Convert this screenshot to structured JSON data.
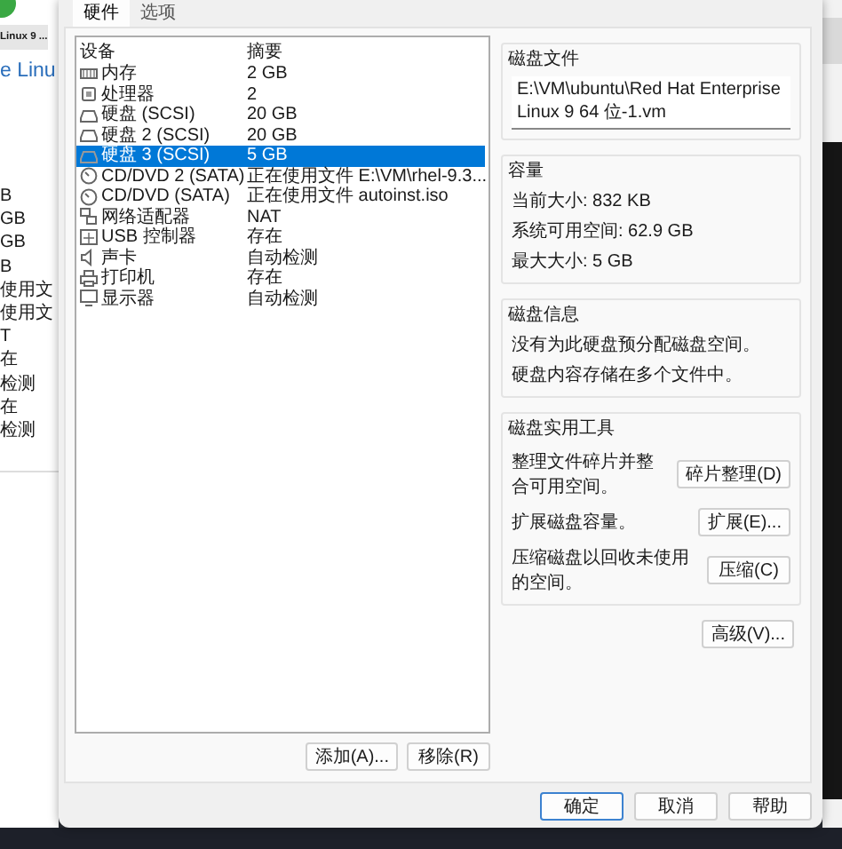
{
  "background_window": {
    "tab": "Linux 9 ...",
    "heading": "e Linu",
    "summaries": [
      "B",
      "GB",
      "GB",
      "B",
      "使用文",
      "使用文",
      "T",
      "在",
      "检测",
      "在",
      "检测"
    ]
  },
  "dialog": {
    "tabs": [
      {
        "label": "硬件",
        "selected": true
      },
      {
        "label": "选项",
        "selected": false
      }
    ],
    "device_list": {
      "columns": [
        "设备",
        "摘要"
      ],
      "rows": [
        {
          "kind": "memory",
          "device": "内存",
          "summary": "2 GB",
          "selected": false
        },
        {
          "kind": "cpu",
          "device": "处理器",
          "summary": "2",
          "selected": false
        },
        {
          "kind": "disk",
          "device": "硬盘 (SCSI)",
          "summary": "20 GB",
          "selected": false
        },
        {
          "kind": "disk",
          "device": "硬盘 2 (SCSI)",
          "summary": "20 GB",
          "selected": false
        },
        {
          "kind": "disk",
          "device": "硬盘 3 (SCSI)",
          "summary": "5 GB",
          "selected": true
        },
        {
          "kind": "cdrom",
          "device": "CD/DVD 2 (SATA)",
          "summary": "正在使用文件 E:\\VM\\rhel-9.3...",
          "selected": false
        },
        {
          "kind": "cdrom",
          "device": "CD/DVD (SATA)",
          "summary": "正在使用文件 autoinst.iso",
          "selected": false
        },
        {
          "kind": "network",
          "device": "网络适配器",
          "summary": "NAT",
          "selected": false
        },
        {
          "kind": "usb",
          "device": "USB 控制器",
          "summary": "存在",
          "selected": false
        },
        {
          "kind": "sound",
          "device": "声卡",
          "summary": "自动检测",
          "selected": false
        },
        {
          "kind": "printer",
          "device": "打印机",
          "summary": "存在",
          "selected": false
        },
        {
          "kind": "display",
          "device": "显示器",
          "summary": "自动检测",
          "selected": false
        }
      ]
    },
    "list_buttons": [
      "添加(A)...",
      "移除(R)"
    ],
    "disk_file": {
      "title": "磁盘文件",
      "value": "E:\\VM\\ubuntu\\Red Hat Enterprise Linux 9 64 位-1.vm"
    },
    "capacity": {
      "title": "容量",
      "lines": [
        "当前大小: 832 KB",
        "系统可用空间: 62.9 GB",
        "最大大小: 5 GB"
      ]
    },
    "disk_info": {
      "title": "磁盘信息",
      "lines": [
        "没有为此硬盘预分配磁盘空间。",
        "硬盘内容存储在多个文件中。"
      ]
    },
    "disk_utilities": {
      "title": "磁盘实用工具",
      "rows": [
        {
          "description": "整理文件碎片并整合可用空间。",
          "button": "碎片整理(D)"
        },
        {
          "description": "扩展磁盘容量。",
          "button": "扩展(E)..."
        },
        {
          "description": "压缩磁盘以回收未使用的空间。",
          "button": "压缩(C)"
        }
      ]
    },
    "advanced_button": "高级(V)...",
    "footer_buttons": [
      {
        "label": "确定",
        "default": true
      },
      {
        "label": "取消",
        "default": false
      },
      {
        "label": "帮助",
        "default": false
      }
    ]
  }
}
